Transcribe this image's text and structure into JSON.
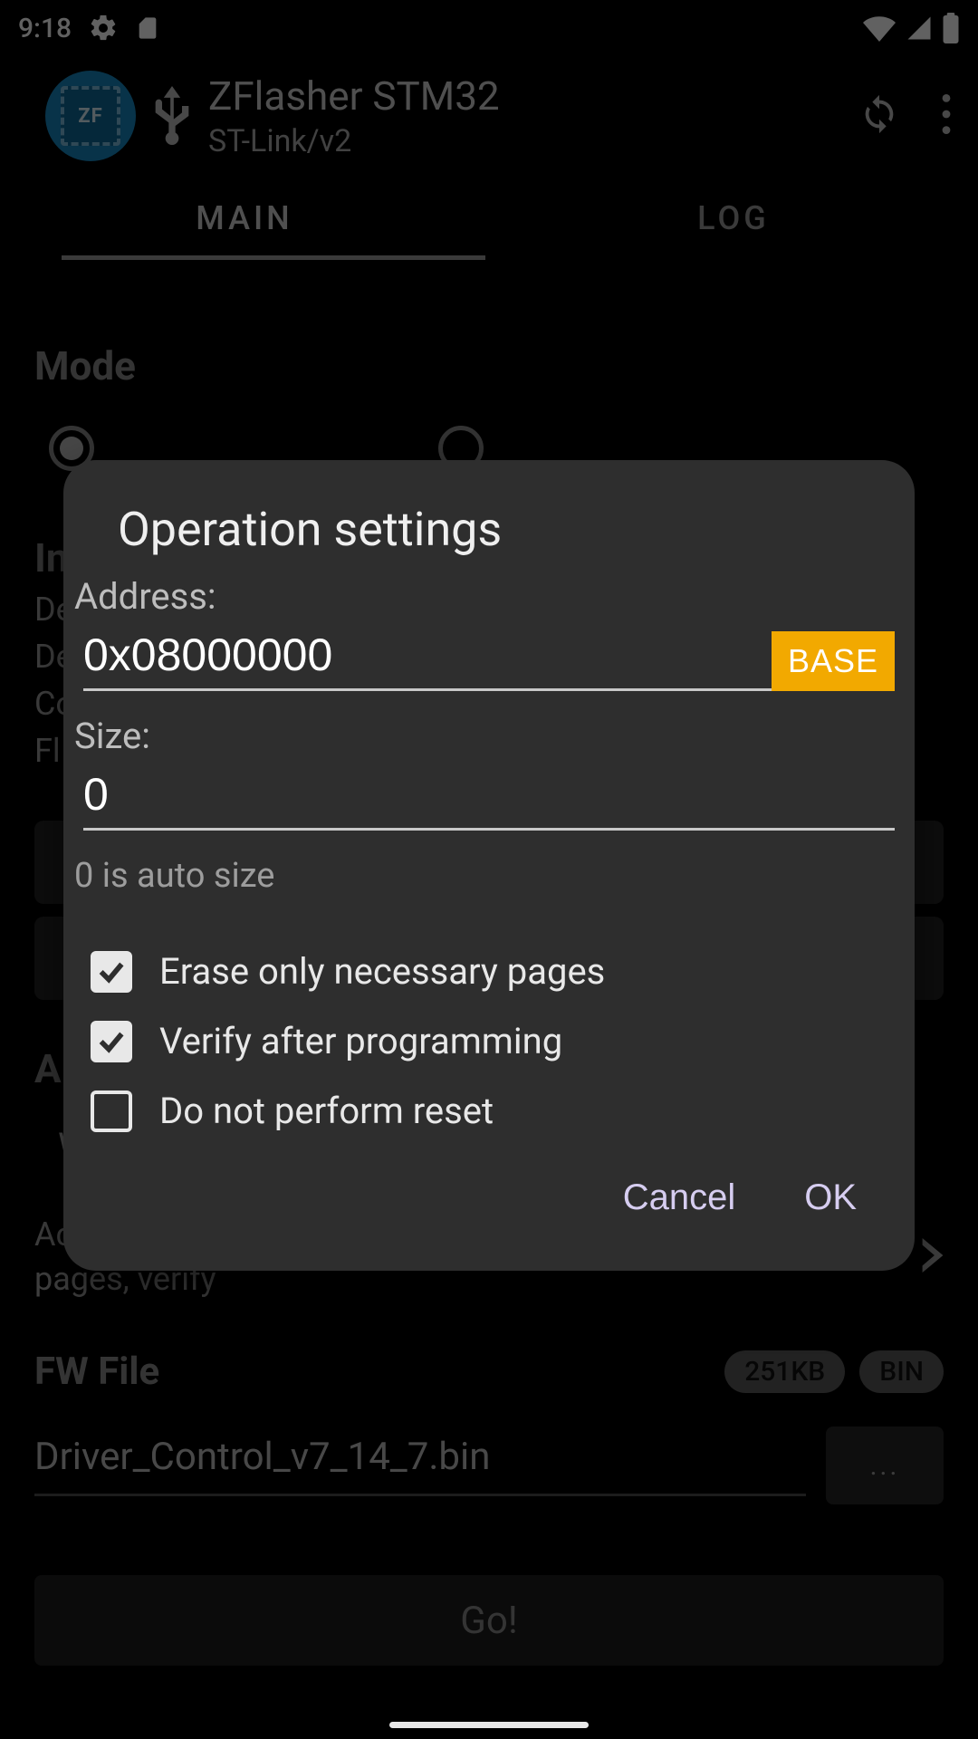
{
  "status_bar": {
    "time": "9:18"
  },
  "app": {
    "title": "ZFlasher STM32",
    "subtitle": "ST-Link/v2",
    "badge_text": "ZF"
  },
  "tabs": {
    "main_label": "MAIN",
    "log_label": "LOG"
  },
  "main": {
    "mode_label": "Mode",
    "info_label": "In",
    "info_lines": {
      "l0": "De",
      "l1": "De",
      "l2": "Co",
      "l3": "Fl"
    },
    "action_label": "A",
    "action_value": "W",
    "more_line1": "Ac",
    "more_line2": "pages, verify",
    "fw_label": "FW File",
    "fw_size": "251KB",
    "fw_type": "BIN",
    "fw_name": "Driver_Control_v7_14_7.bin",
    "browse_label": "...",
    "go_label": "Go!"
  },
  "dialog": {
    "title": "Operation settings",
    "address_label": "Address:",
    "address_value": "0x08000000",
    "base_label": "BASE",
    "size_label": "Size:",
    "size_value": "0",
    "size_hint": "0 is auto size",
    "checks": {
      "erase": {
        "label": "Erase only necessary pages",
        "checked": true
      },
      "verify": {
        "label": "Verify after programming",
        "checked": true
      },
      "noreset": {
        "label": "Do not perform reset",
        "checked": false
      }
    },
    "cancel_label": "Cancel",
    "ok_label": "OK"
  }
}
